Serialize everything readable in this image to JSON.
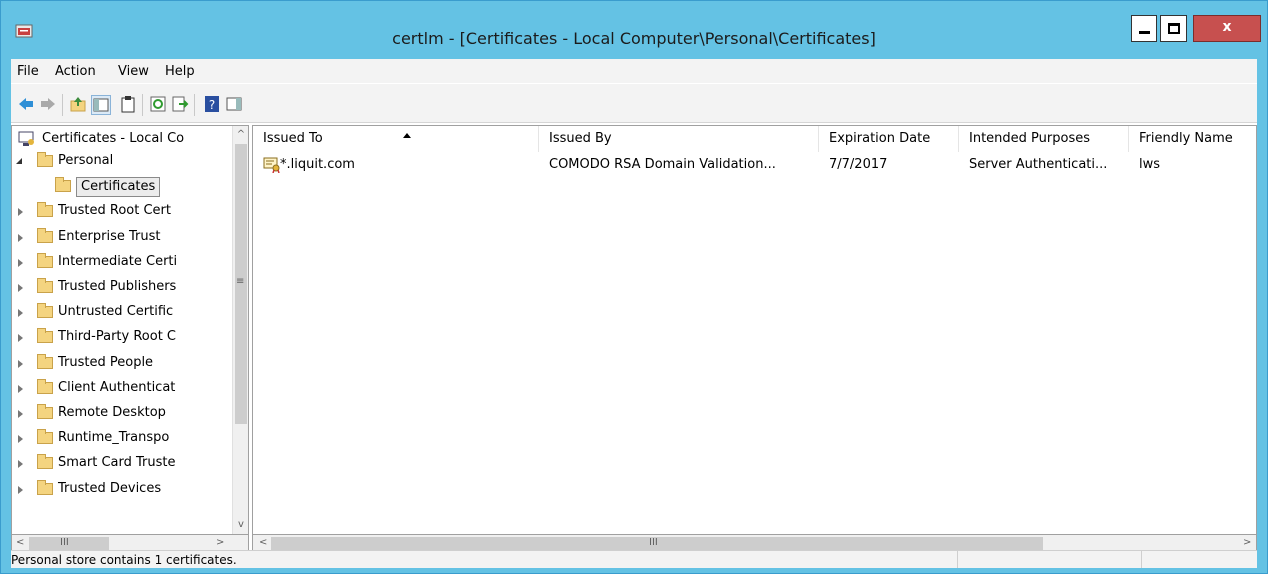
{
  "window": {
    "title": "certlm - [Certificates - Local Computer\\Personal\\Certificates]",
    "close_label": "x"
  },
  "menu": [
    "File",
    "Action",
    "View",
    "Help"
  ],
  "tree": {
    "root": "Certificates - Local Co",
    "items": [
      {
        "label": "Personal",
        "expanded": true
      },
      {
        "label": "Certificates",
        "selected": true
      },
      {
        "label": "Trusted Root Cert"
      },
      {
        "label": "Enterprise Trust"
      },
      {
        "label": "Intermediate Certi"
      },
      {
        "label": "Trusted Publishers"
      },
      {
        "label": "Untrusted Certific"
      },
      {
        "label": "Third-Party Root C"
      },
      {
        "label": "Trusted People"
      },
      {
        "label": "Client Authenticat"
      },
      {
        "label": "Remote Desktop"
      },
      {
        "label": "Runtime_Transpo"
      },
      {
        "label": "Smart Card Truste"
      },
      {
        "label": "Trusted Devices"
      }
    ]
  },
  "list": {
    "columns": [
      "Issued To",
      "Issued By",
      "Expiration Date",
      "Intended Purposes",
      "Friendly Name"
    ],
    "rows": [
      {
        "issued_to": "*.liquit.com",
        "issued_by": "COMODO RSA Domain Validation...",
        "expiration": "7/7/2017",
        "purposes": "Server Authenticati...",
        "friendly": "lws"
      }
    ]
  },
  "status": {
    "text": "Personal store contains 1 certificates."
  },
  "colors": {
    "title_bar": "#64c2e4",
    "close_button": "#c7504f"
  }
}
